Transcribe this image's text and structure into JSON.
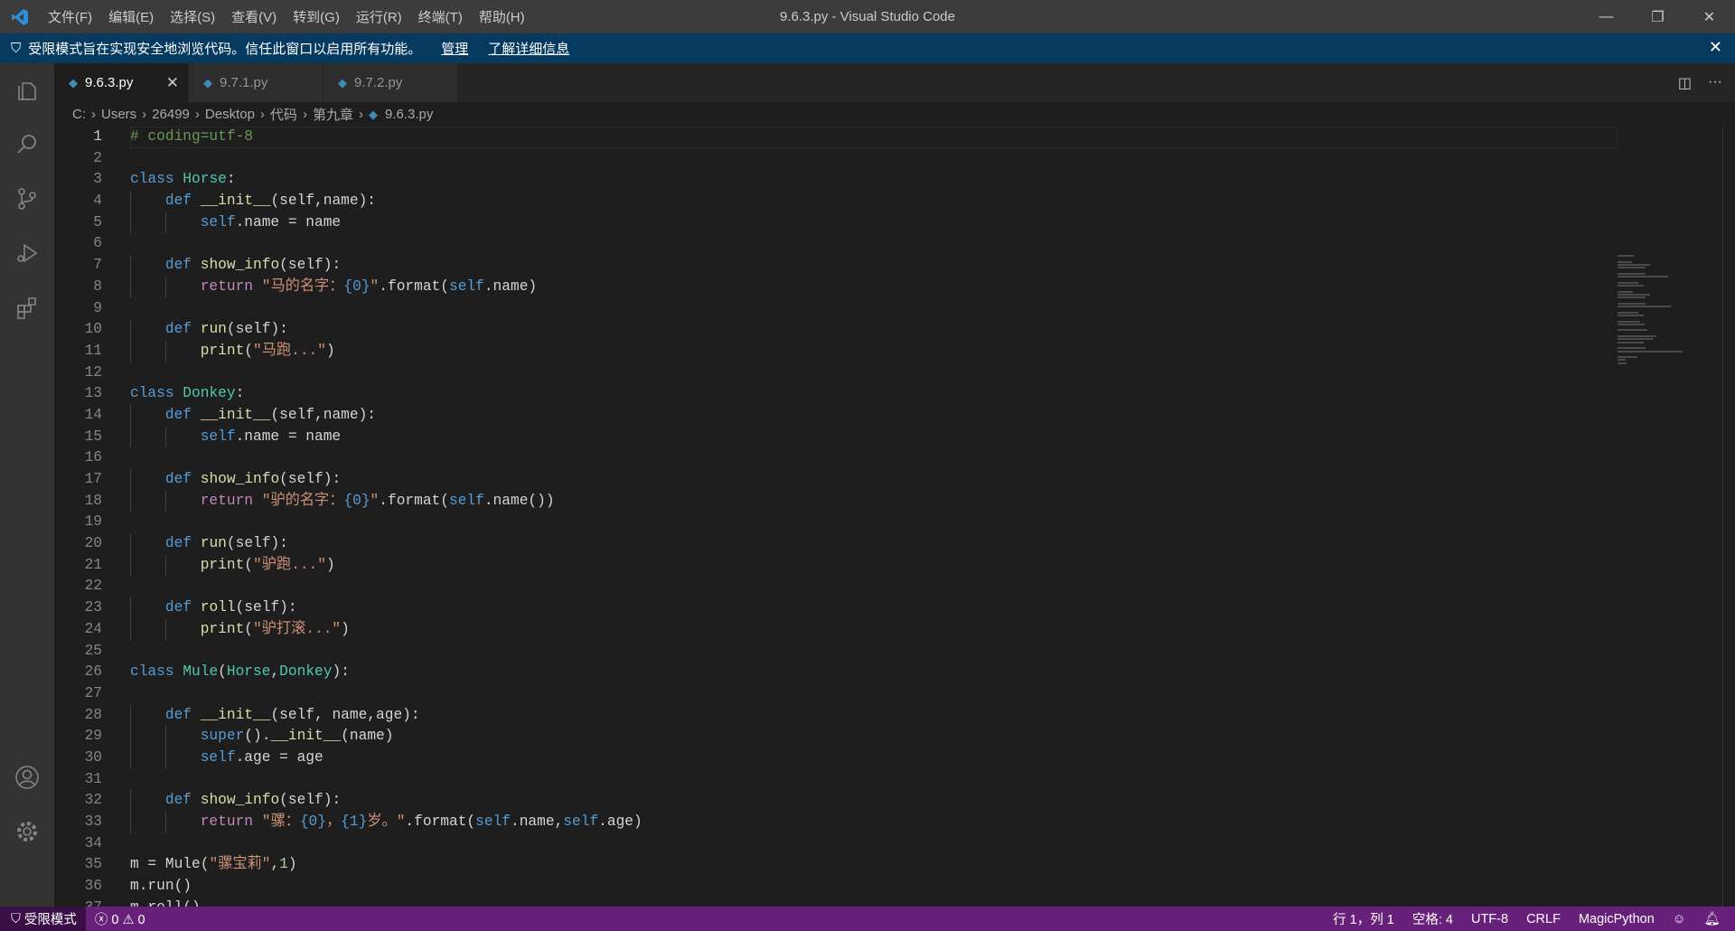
{
  "titlebar": {
    "menu": [
      "文件(F)",
      "编辑(E)",
      "选择(S)",
      "查看(V)",
      "转到(G)",
      "运行(R)",
      "终端(T)",
      "帮助(H)"
    ],
    "title": "9.6.3.py - Visual Studio Code"
  },
  "banner": {
    "text": "受限模式旨在实现安全地浏览代码。信任此窗口以启用所有功能。",
    "manage": "管理",
    "learn_more": "了解详细信息"
  },
  "tabs": [
    {
      "label": "9.6.3.py",
      "active": true
    },
    {
      "label": "9.7.1.py",
      "active": false
    },
    {
      "label": "9.7.2.py",
      "active": false
    }
  ],
  "breadcrumbs": [
    "C:",
    "Users",
    "26499",
    "Desktop",
    "代码",
    "第九章",
    "9.6.3.py"
  ],
  "editor": {
    "current_line": 1,
    "lines": [
      [
        [
          "# coding=utf-8",
          "cm"
        ]
      ],
      [],
      [
        [
          "class",
          "kw"
        ],
        [
          " "
        ],
        [
          "Horse",
          "cls"
        ],
        [
          ":"
        ]
      ],
      [
        [
          "    "
        ],
        [
          "def",
          "kw"
        ],
        [
          " "
        ],
        [
          "__init__",
          "fn"
        ],
        [
          "(self,name):"
        ]
      ],
      [
        [
          "        "
        ],
        [
          "self",
          "slf"
        ],
        [
          ".name = name"
        ]
      ],
      [],
      [
        [
          "    "
        ],
        [
          "def",
          "kw"
        ],
        [
          " "
        ],
        [
          "show_info",
          "fn"
        ],
        [
          "(self):"
        ]
      ],
      [
        [
          "        "
        ],
        [
          "return",
          "ret"
        ],
        [
          " "
        ],
        [
          "\"马的名字：",
          "str"
        ],
        [
          "{0}",
          "kw"
        ],
        [
          "\"",
          "str"
        ],
        [
          ".format("
        ],
        [
          "self",
          "slf"
        ],
        [
          ".name)"
        ]
      ],
      [],
      [
        [
          "    "
        ],
        [
          "def",
          "kw"
        ],
        [
          " "
        ],
        [
          "run",
          "fn"
        ],
        [
          "(self):"
        ]
      ],
      [
        [
          "        "
        ],
        [
          "print",
          "fn"
        ],
        [
          "("
        ],
        [
          "\"马跑...\"",
          "str"
        ],
        [
          ")"
        ]
      ],
      [],
      [
        [
          "class",
          "kw"
        ],
        [
          " "
        ],
        [
          "Donkey",
          "cls"
        ],
        [
          ":"
        ]
      ],
      [
        [
          "    "
        ],
        [
          "def",
          "kw"
        ],
        [
          " "
        ],
        [
          "__init__",
          "fn"
        ],
        [
          "(self,name):"
        ]
      ],
      [
        [
          "        "
        ],
        [
          "self",
          "slf"
        ],
        [
          ".name = name"
        ]
      ],
      [],
      [
        [
          "    "
        ],
        [
          "def",
          "kw"
        ],
        [
          " "
        ],
        [
          "show_info",
          "fn"
        ],
        [
          "(self):"
        ]
      ],
      [
        [
          "        "
        ],
        [
          "return",
          "ret"
        ],
        [
          " "
        ],
        [
          "\"驴的名字：",
          "str"
        ],
        [
          "{0}",
          "kw"
        ],
        [
          "\"",
          "str"
        ],
        [
          ".format("
        ],
        [
          "self",
          "slf"
        ],
        [
          ".name())"
        ]
      ],
      [],
      [
        [
          "    "
        ],
        [
          "def",
          "kw"
        ],
        [
          " "
        ],
        [
          "run",
          "fn"
        ],
        [
          "(self):"
        ]
      ],
      [
        [
          "        "
        ],
        [
          "print",
          "fn"
        ],
        [
          "("
        ],
        [
          "\"驴跑...\"",
          "str"
        ],
        [
          ")"
        ]
      ],
      [],
      [
        [
          "    "
        ],
        [
          "def",
          "kw"
        ],
        [
          " "
        ],
        [
          "roll",
          "fn"
        ],
        [
          "(self):"
        ]
      ],
      [
        [
          "        "
        ],
        [
          "print",
          "fn"
        ],
        [
          "("
        ],
        [
          "\"驴打滚...\"",
          "str"
        ],
        [
          ")"
        ]
      ],
      [],
      [
        [
          "class",
          "kw"
        ],
        [
          " "
        ],
        [
          "Mule",
          "cls"
        ],
        [
          "("
        ],
        [
          "Horse",
          "cls"
        ],
        [
          ","
        ],
        [
          "Donkey",
          "cls"
        ],
        [
          "):"
        ]
      ],
      [],
      [
        [
          "    "
        ],
        [
          "def",
          "kw"
        ],
        [
          " "
        ],
        [
          "__init__",
          "fn"
        ],
        [
          "(self, name,age):"
        ]
      ],
      [
        [
          "        "
        ],
        [
          "super",
          "kw"
        ],
        [
          "()."
        ],
        [
          "__init__",
          "fn"
        ],
        [
          "(name)"
        ]
      ],
      [
        [
          "        "
        ],
        [
          "self",
          "slf"
        ],
        [
          ".age = age"
        ]
      ],
      [],
      [
        [
          "    "
        ],
        [
          "def",
          "kw"
        ],
        [
          " "
        ],
        [
          "show_info",
          "fn"
        ],
        [
          "(self):"
        ]
      ],
      [
        [
          "        "
        ],
        [
          "return",
          "ret"
        ],
        [
          " "
        ],
        [
          "\"骡：",
          "str"
        ],
        [
          "{0}",
          "kw"
        ],
        [
          "，",
          "str"
        ],
        [
          "{1}",
          "kw"
        ],
        [
          "岁。\"",
          "str"
        ],
        [
          ".format("
        ],
        [
          "self",
          "slf"
        ],
        [
          ".name,"
        ],
        [
          "self",
          "slf"
        ],
        [
          ".age)"
        ]
      ],
      [],
      [
        [
          "m = Mule("
        ],
        [
          "\"骡宝莉\"",
          "str"
        ],
        [
          ","
        ],
        [
          "1",
          "num"
        ],
        [
          ")"
        ]
      ],
      [
        [
          "m.run()"
        ]
      ],
      [
        [
          "m.roll()"
        ]
      ]
    ]
  },
  "statusbar": {
    "restricted": "受限模式",
    "errors": "0",
    "warnings": "0",
    "position": "行 1，列 1",
    "spaces": "空格: 4",
    "encoding": "UTF-8",
    "eol": "CRLF",
    "language": "MagicPython"
  },
  "colors": {
    "statusbar": "#68217a",
    "banner": "#063b5f",
    "keyword": "#569cd6",
    "class": "#4ec9b0",
    "function": "#dcdcaa",
    "string": "#ce9178",
    "comment": "#6a9955"
  }
}
